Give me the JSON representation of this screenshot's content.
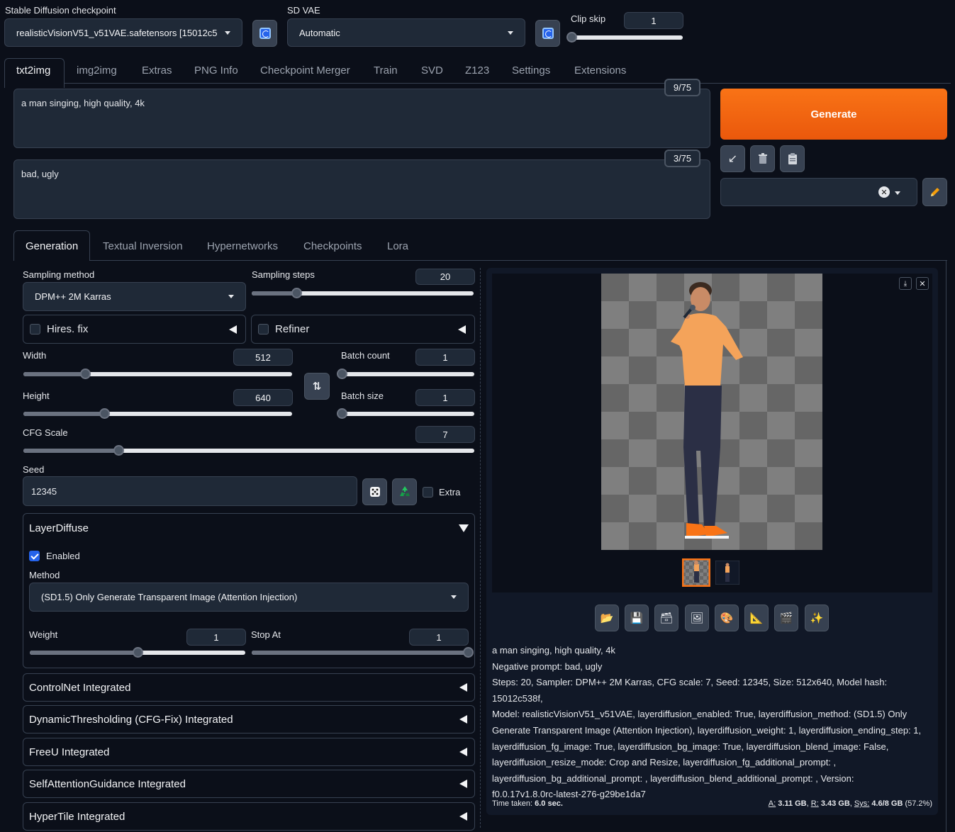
{
  "top": {
    "checkpoint_label": "Stable Diffusion checkpoint",
    "checkpoint_value": "realisticVisionV51_v51VAE.safetensors [15012c5",
    "vae_label": "SD VAE",
    "vae_value": "Automatic",
    "clip_skip_label": "Clip skip",
    "clip_skip_value": "1"
  },
  "main_tabs": [
    "txt2img",
    "img2img",
    "Extras",
    "PNG Info",
    "Checkpoint Merger",
    "Train",
    "SVD",
    "Z123",
    "Settings",
    "Extensions"
  ],
  "prompt": {
    "positive": "a man singing, high quality, 4k",
    "positive_count": "9/75",
    "negative": "bad, ugly",
    "negative_count": "3/75"
  },
  "generate_label": "Generate",
  "sub_tabs": [
    "Generation",
    "Textual Inversion",
    "Hypernetworks",
    "Checkpoints",
    "Lora"
  ],
  "generation": {
    "sampling_method_label": "Sampling method",
    "sampling_method_value": "DPM++ 2M Karras",
    "sampling_steps_label": "Sampling steps",
    "sampling_steps_value": "20",
    "sampling_steps_level": 0.2,
    "hires_label": "Hires. fix",
    "refiner_label": "Refiner",
    "width_label": "Width",
    "width_value": "512",
    "width_level": 0.23,
    "height_label": "Height",
    "height_value": "640",
    "height_level": 0.3,
    "batch_count_label": "Batch count",
    "batch_count_value": "1",
    "batch_size_label": "Batch size",
    "batch_size_value": "1",
    "cfg_label": "CFG Scale",
    "cfg_value": "7",
    "cfg_level": 0.21,
    "seed_label": "Seed",
    "seed_value": "12345",
    "extra_label": "Extra"
  },
  "layerdiffuse": {
    "title": "LayerDiffuse",
    "enabled_label": "Enabled",
    "method_label": "Method",
    "method_value": "(SD1.5) Only Generate Transparent Image (Attention Injection)",
    "weight_label": "Weight",
    "weight_value": "1",
    "weight_level": 0.5,
    "stop_label": "Stop At",
    "stop_value": "1",
    "stop_level": 1.0
  },
  "accordions": [
    "ControlNet Integrated",
    "DynamicThresholding (CFG-Fix) Integrated",
    "FreeU Integrated",
    "SelfAttentionGuidance Integrated",
    "HyperTile Integrated"
  ],
  "output": {
    "info_lines": [
      "a man singing, high quality, 4k",
      "Negative prompt: bad, ugly",
      "Steps: 20, Sampler: DPM++ 2M Karras, CFG scale: 7, Seed: 12345, Size: 512x640, Model hash: 15012c538f,",
      "Model: realisticVisionV51_v51VAE, layerdiffusion_enabled: True, layerdiffusion_method: (SD1.5) Only",
      "Generate Transparent Image (Attention Injection), layerdiffusion_weight: 1, layerdiffusion_ending_step: 1,",
      "layerdiffusion_fg_image: True, layerdiffusion_bg_image: True, layerdiffusion_blend_image: False,",
      "layerdiffusion_resize_mode: Crop and Resize, layerdiffusion_fg_additional_prompt: ,",
      "layerdiffusion_bg_additional_prompt: , layerdiffusion_blend_additional_prompt: , Version:",
      "f0.0.17v1.8.0rc-latest-276-g29be1da7"
    ],
    "time_label": "Time taken:",
    "time_value": "6.0 sec.",
    "mem_a_label": "A:",
    "mem_a": "3.11 GB",
    "mem_r_label": "R:",
    "mem_r": "3.43 GB",
    "mem_sys_label": "Sys:",
    "mem_sys": "4.6/8 GB",
    "mem_pct": "(57.2%)"
  },
  "colors": {
    "accent": "#f97316",
    "bg": "#0b0f19",
    "panel": "#1f2937",
    "check": "#2563eb"
  }
}
